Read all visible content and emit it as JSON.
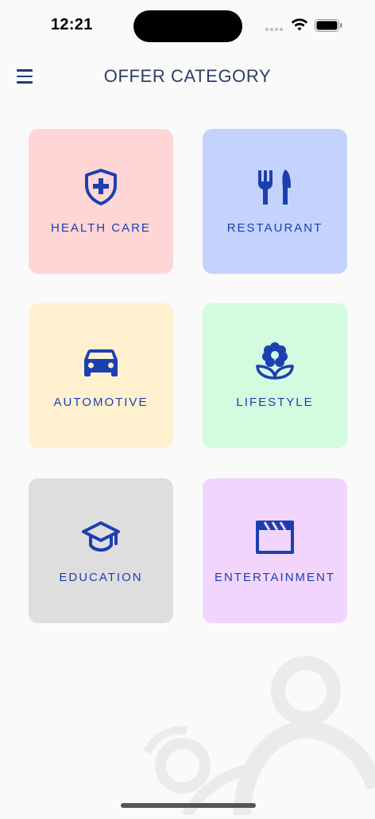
{
  "status_bar": {
    "time": "12:21"
  },
  "header": {
    "title": "OFFER CATEGORY"
  },
  "colors": {
    "accent": "#1c3fb0",
    "title": "#2b3e65"
  },
  "categories": [
    {
      "label": "HEALTH CARE",
      "icon": "shield-plus-icon",
      "color": "#ffd6d6"
    },
    {
      "label": "RESTAURANT",
      "icon": "fork-knife-icon",
      "color": "#c3d3fd"
    },
    {
      "label": "AUTOMOTIVE",
      "icon": "car-icon",
      "color": "#fff1d0"
    },
    {
      "label": "LIFESTYLE",
      "icon": "flower-icon",
      "color": "#d2fbdf"
    },
    {
      "label": "EDUCATION",
      "icon": "graduation-cap-icon",
      "color": "#dedede"
    },
    {
      "label": "ENTERTAINMENT",
      "icon": "clapperboard-icon",
      "color": "#f2d5fd"
    }
  ]
}
